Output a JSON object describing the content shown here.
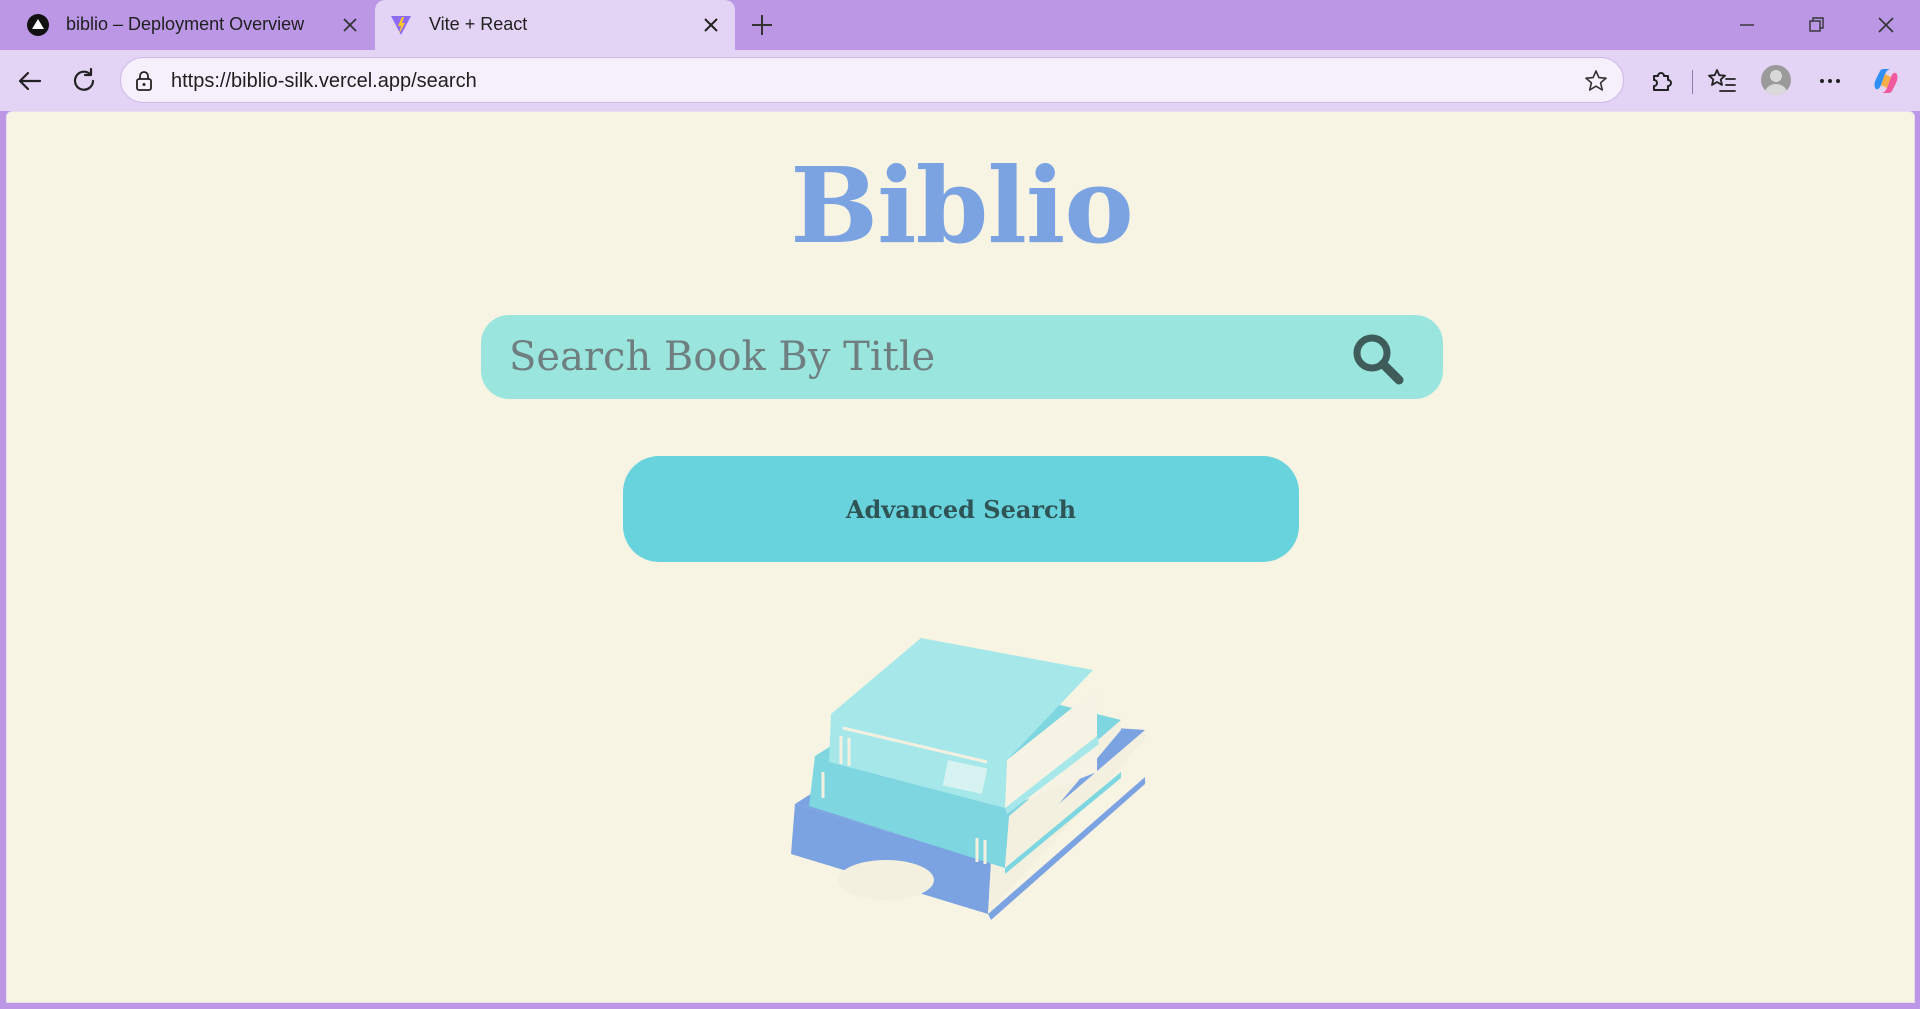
{
  "browser": {
    "tabs": [
      {
        "title": "biblio – Deployment Overview",
        "favicon": "vercel-logo-icon",
        "active": false
      },
      {
        "title": "Vite + React",
        "favicon": "vite-logo-icon",
        "active": true
      }
    ],
    "url": "https://biblio-silk.vercel.app/search",
    "toolbar_icons": [
      "back-icon",
      "refresh-icon",
      "lock-icon",
      "favorite-star-icon",
      "extensions-icon",
      "favorites-icon",
      "profile-avatar",
      "more-icon",
      "copilot-icon"
    ]
  },
  "page": {
    "logo": "Biblio",
    "search": {
      "placeholder": "Search Book By Title",
      "value": ""
    },
    "advanced_search_label": "Advanced Search"
  },
  "colors": {
    "frame": "#bb97e6",
    "toolbar": "#e3d3f5",
    "page_bg": "#f8f4e3",
    "logo": "#7ba3e2",
    "search_bg": "#9ae6df",
    "button_bg": "#69d3dd",
    "icon_dark": "#3f5b5a"
  }
}
